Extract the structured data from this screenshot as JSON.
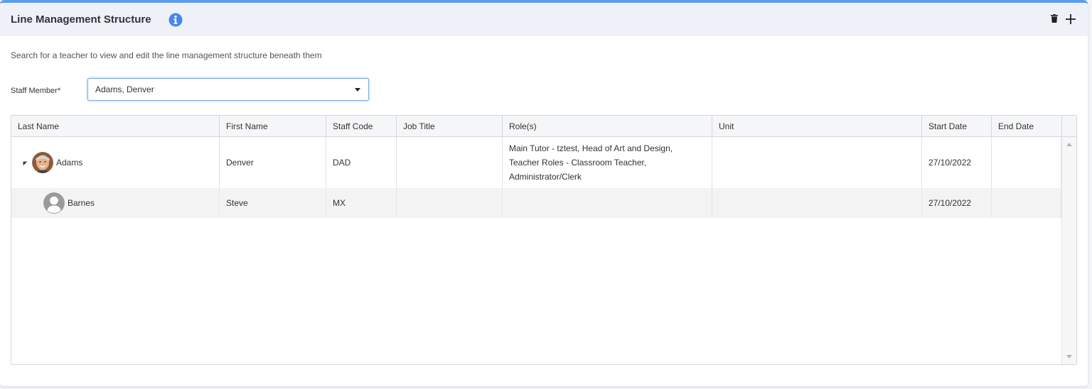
{
  "header": {
    "title": "Line Management Structure",
    "info_icon": "info-circle-icon",
    "actions": [
      {
        "name": "delete",
        "icon": "trash-icon"
      },
      {
        "name": "add",
        "icon": "plus-icon"
      }
    ]
  },
  "instruction": "Search for a teacher to view and edit the line management structure beneath them",
  "staff_member": {
    "label": "Staff Member*",
    "value": "Adams, Denver"
  },
  "table": {
    "columns": [
      "Last Name",
      "First Name",
      "Staff Code",
      "Job Title",
      "Role(s)",
      "Unit",
      "Start Date",
      "End Date"
    ],
    "rows": [
      {
        "last_name": "Adams",
        "first_name": "Denver",
        "staff_code": "DAD",
        "job_title": "",
        "roles": "Main Tutor - tztest, Head of Art and Design, Teacher Roles - Classroom Teacher, Administrator/Clerk",
        "unit": "",
        "start_date": "27/10/2022",
        "end_date": "",
        "expanded": true,
        "avatar": "photo"
      },
      {
        "last_name": "Barnes",
        "first_name": "Steve",
        "staff_code": "MX",
        "job_title": "",
        "roles": "",
        "unit": "",
        "start_date": "27/10/2022",
        "end_date": "",
        "avatar": "placeholder"
      }
    ]
  },
  "colors": {
    "accent": "#5b9cf0",
    "info_icon": "#4a86e8",
    "header_bg": "#eef2f8",
    "alt_row_bg": "#f3f3f3"
  }
}
